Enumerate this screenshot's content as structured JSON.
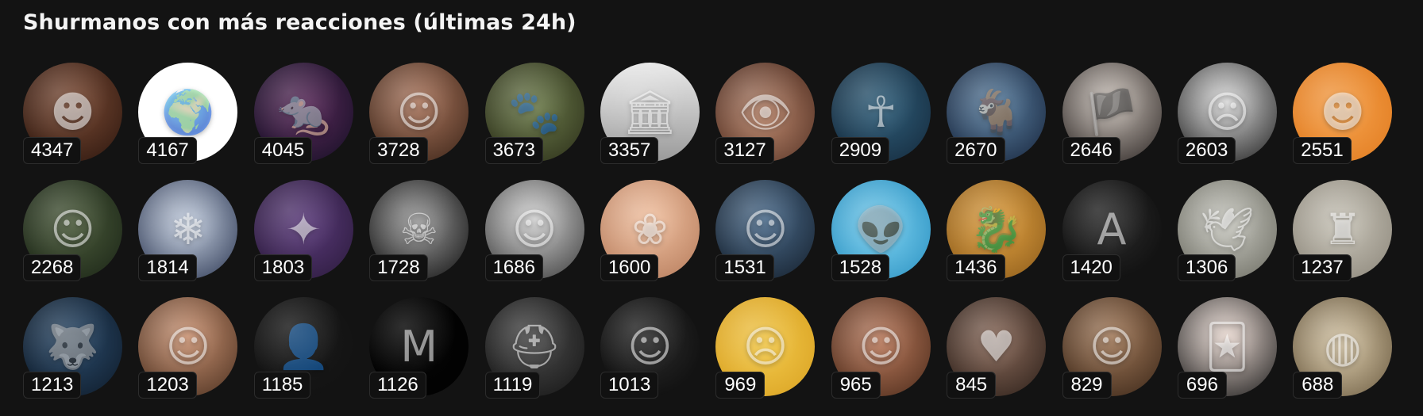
{
  "header": {
    "title": "Shurmanos con más reacciones (últimas 24h)"
  },
  "users": [
    {
      "count": "4347",
      "icon": "dark-hair-portrait-icon",
      "bg": "radial-gradient(circle at 50% 40%, #7a4a34, #2b160e)",
      "glyph": "☻"
    },
    {
      "count": "4167",
      "icon": "globe-icon",
      "bg": "radial-gradient(circle at 50% 50%, #ffffff 0%, #ffffff 48%, #ffffff 100%)",
      "glyph": "🌍"
    },
    {
      "count": "4045",
      "icon": "rat-icon",
      "bg": "radial-gradient(circle at 50% 45%, #5a2a5a, #140f24)",
      "glyph": "🐀"
    },
    {
      "count": "3728",
      "icon": "woman-portrait-icon",
      "bg": "radial-gradient(circle at 50% 40%, #a8735a, #3a2418)",
      "glyph": "☺"
    },
    {
      "count": "3673",
      "icon": "cartoon-animals-icon",
      "bg": "radial-gradient(circle at 50% 45%, #6b7a4a, #2a2d18)",
      "glyph": "🐾"
    },
    {
      "count": "3357",
      "icon": "building-hall-icon",
      "bg": "linear-gradient(#e9e9e9, #9a9a9a)",
      "glyph": "🏛"
    },
    {
      "count": "3127",
      "icon": "eye-icon",
      "bg": "radial-gradient(circle at 50% 55%, #b8846a, #4a2a1e)",
      "glyph": "👁"
    },
    {
      "count": "2909",
      "icon": "anubis-icon",
      "bg": "radial-gradient(circle at 50% 45%, #2f5e7a, #14283a)",
      "glyph": "☥"
    },
    {
      "count": "2670",
      "icon": "goat-icon",
      "bg": "radial-gradient(circle at 50% 45%, #5a7fa0, #16233a)",
      "glyph": "🐐"
    },
    {
      "count": "2646",
      "icon": "pirate-icon",
      "bg": "radial-gradient(circle at 50% 40%, #c9c0b8, #2a2422)",
      "glyph": "🏴"
    },
    {
      "count": "2603",
      "icon": "man-bw-portrait-icon",
      "bg": "radial-gradient(circle at 50% 40%, #d8d8d8, #1e1e1e)",
      "glyph": "☹"
    },
    {
      "count": "2551",
      "icon": "cartoon-character-icon",
      "bg": "radial-gradient(circle at 50% 50%, #f5a04a, #e07a1e)",
      "glyph": "☻"
    },
    {
      "count": "2268",
      "icon": "woman-yellow-shirt-icon",
      "bg": "radial-gradient(circle at 50% 45%, #4a5a3a, #1a2416)",
      "glyph": "☺"
    },
    {
      "count": "1814",
      "icon": "white-haired-figure-icon",
      "bg": "radial-gradient(circle at 50% 45%, #c4cfe0, #2a3550)",
      "glyph": "❄"
    },
    {
      "count": "1803",
      "icon": "cartoon-scene-icon",
      "bg": "radial-gradient(circle at 50% 45%, #5a3a7a, #2a1a3a)",
      "glyph": "✦"
    },
    {
      "count": "1728",
      "icon": "skull-priest-icon",
      "bg": "radial-gradient(circle at 50% 45%, #9a9a9a, #0e0e0e)",
      "glyph": "☠"
    },
    {
      "count": "1686",
      "icon": "man-classic-portrait-icon",
      "bg": "radial-gradient(circle at 50% 40%, #d0d0d0, #3a3a3a)",
      "glyph": "☺"
    },
    {
      "count": "1600",
      "icon": "woman-painting-icon",
      "bg": "radial-gradient(circle at 50% 40%, #f0c0a0, #b47a5a)",
      "glyph": "❀"
    },
    {
      "count": "1531",
      "icon": "man-dark-jacket-icon",
      "bg": "radial-gradient(circle at 50% 40%, #4a6a8a, #141e2a)",
      "glyph": "☺"
    },
    {
      "count": "1528",
      "icon": "green-creature-icon",
      "bg": "radial-gradient(circle at 50% 50%, #7ad0f0, #2a90c0)",
      "glyph": "👽"
    },
    {
      "count": "1436",
      "icon": "dragon-icon",
      "bg": "radial-gradient(circle at 50% 45%, #e0a040, #8a5a1a)",
      "glyph": "🐉"
    },
    {
      "count": "1420",
      "icon": "almeida-banner-icon",
      "bg": "radial-gradient(circle at 50% 45%, #2a2a2a, #0a0a0a)",
      "glyph": "A"
    },
    {
      "count": "1306",
      "icon": "seagull-icon",
      "bg": "radial-gradient(circle at 50% 45%, #c8c8c0, #6a6a60)",
      "glyph": "🕊"
    },
    {
      "count": "1237",
      "icon": "garden-gnome-icon",
      "bg": "radial-gradient(circle at 50% 45%, #c8c4b8, #8a8478)",
      "glyph": "♜"
    },
    {
      "count": "1213",
      "icon": "wolf-icon",
      "bg": "radial-gradient(circle at 50% 45%, #2a4a6a, #0e1a28)",
      "glyph": "🐺"
    },
    {
      "count": "1203",
      "icon": "smiling-man-icon",
      "bg": "radial-gradient(circle at 50% 40%, #c89070, #4a3020)",
      "glyph": "☺"
    },
    {
      "count": "1185",
      "icon": "cartoon-suit-man-icon",
      "bg": "radial-gradient(circle at 50% 45%, #1a1a1a, #101010)",
      "glyph": "👤"
    },
    {
      "count": "1126",
      "icon": "letter-m-logo-icon",
      "bg": "radial-gradient(circle at 50% 50%, #050505, #000000)",
      "glyph": "M"
    },
    {
      "count": "1119",
      "icon": "soldier-helmet-icon",
      "bg": "radial-gradient(circle at 50% 45%, #4a4a4a, #141414)",
      "glyph": "⛑"
    },
    {
      "count": "1013",
      "icon": "officer-sunglasses-icon",
      "bg": "radial-gradient(circle at 50% 45%, #2a2a2a, #0a0a0a)",
      "glyph": "☺"
    },
    {
      "count": "969",
      "icon": "squidward-icon",
      "bg": "radial-gradient(circle at 50% 50%, #f2c84a, #d8a020)",
      "glyph": "☹"
    },
    {
      "count": "965",
      "icon": "woke-cap-man-icon",
      "bg": "radial-gradient(circle at 50% 45%, #b8785a, #4a2a1a)",
      "glyph": "☺"
    },
    {
      "count": "845",
      "icon": "couple-photo-icon",
      "bg": "radial-gradient(circle at 50% 45%, #8a6a5a, #2a1e18)",
      "glyph": "♥"
    },
    {
      "count": "829",
      "icon": "long-hair-man-icon",
      "bg": "radial-gradient(circle at 50% 40%, #a07858, #3a2618)",
      "glyph": "☺"
    },
    {
      "count": "696",
      "icon": "joker-icon",
      "bg": "radial-gradient(circle at 50% 40%, #e8d8d0, #1a1a1a)",
      "glyph": "🃏"
    },
    {
      "count": "688",
      "icon": "food-bowl-icon",
      "bg": "radial-gradient(circle at 50% 50%, #d8c8a8, #6a5a40)",
      "glyph": "◍"
    }
  ]
}
